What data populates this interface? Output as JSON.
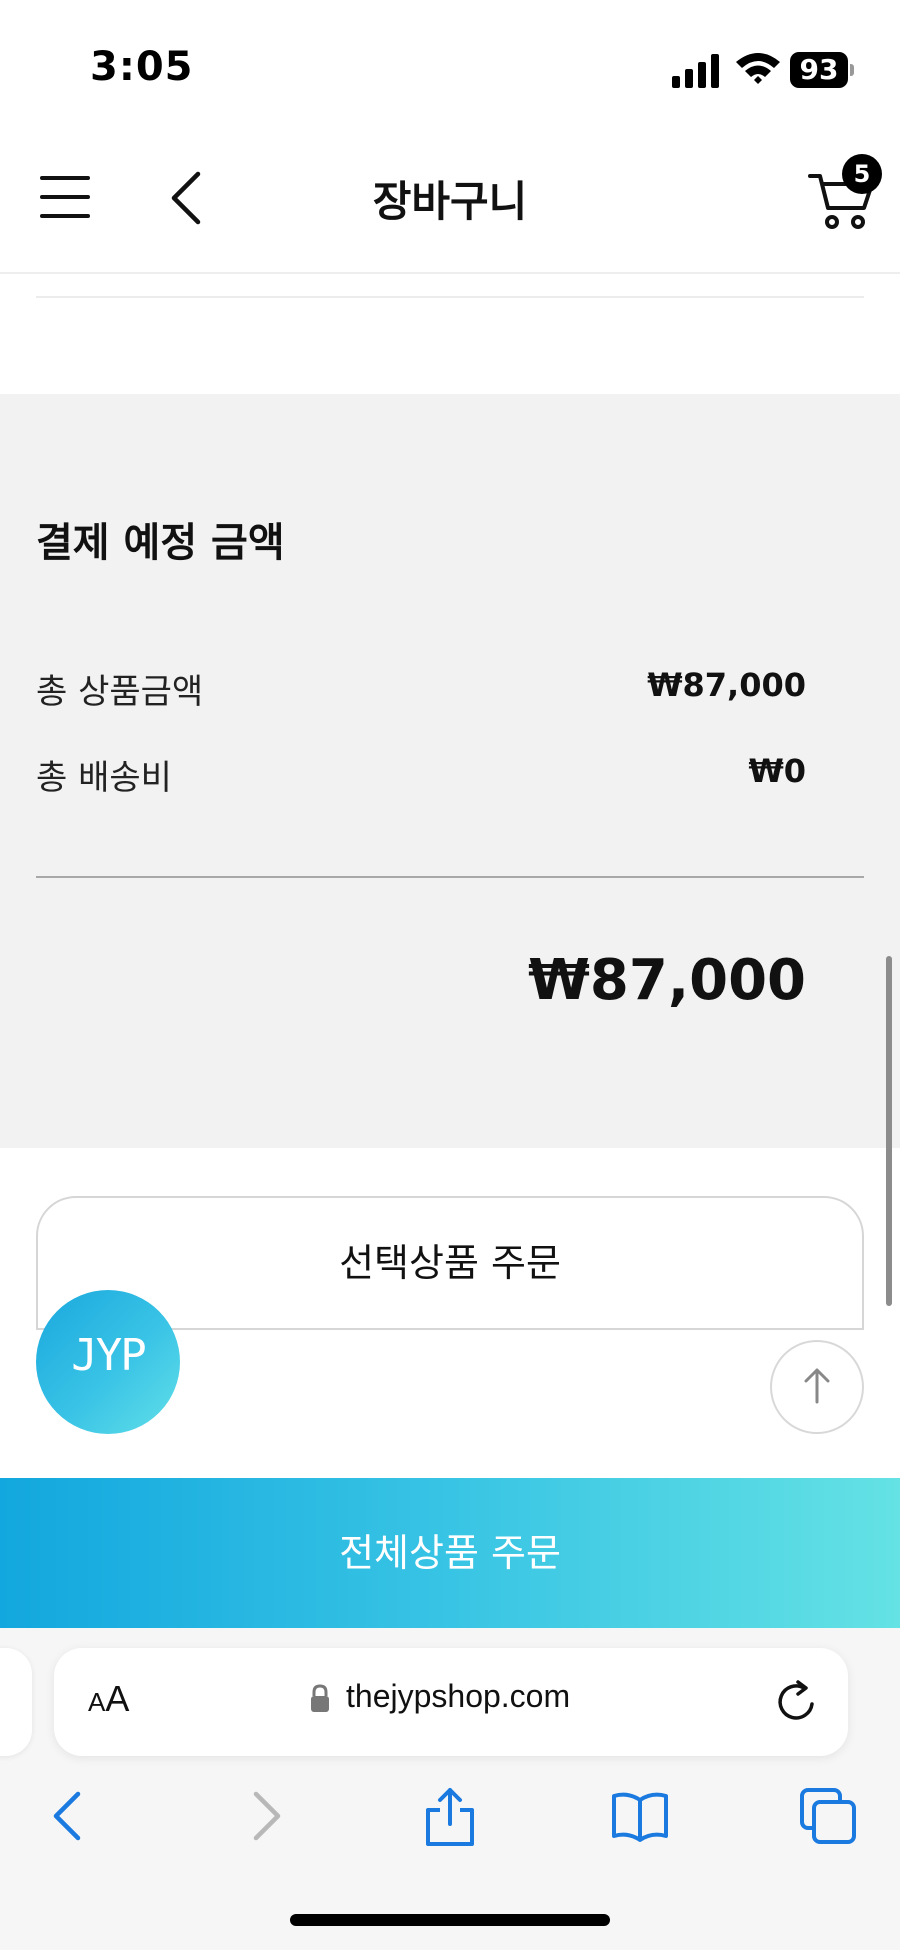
{
  "status_bar": {
    "time": "3:05",
    "battery": "93"
  },
  "header": {
    "title": "장바구니",
    "cart_count": "5"
  },
  "summary": {
    "title": "결제 예정 금액",
    "rows": [
      {
        "label": "총 상품금액",
        "value": "₩87,000"
      },
      {
        "label": "총 배송비",
        "value": "₩0"
      }
    ],
    "total": "₩87,000"
  },
  "buttons": {
    "order_selected": "선택상품 주문",
    "order_all": "전체상품 주문",
    "fab_logo": "JYP"
  },
  "browser": {
    "aa_small": "A",
    "aa_large": "A",
    "url": "thejypshop.com"
  },
  "colors": {
    "accent_start": "#12a7de",
    "accent_end": "#64e2e4",
    "panel_bg": "#f2f2f2",
    "safari_blue": "#1a7ae0"
  }
}
